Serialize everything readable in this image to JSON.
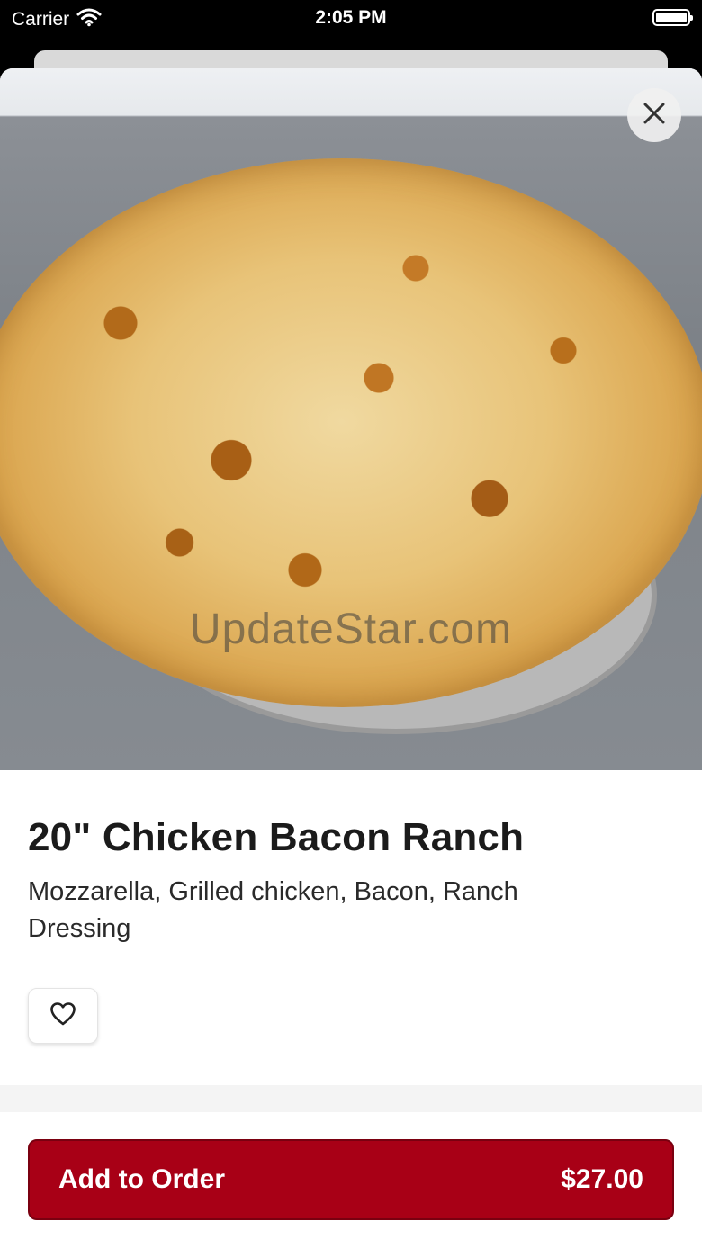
{
  "status_bar": {
    "carrier": "Carrier",
    "time": "2:05 PM",
    "wifi_icon": "wifi-icon",
    "battery_icon": "battery-full-icon"
  },
  "hero": {
    "image_subject": "pizza photo",
    "watermark": "UpdateStar.com",
    "close_icon": "close-icon"
  },
  "item": {
    "title": "20\" Chicken Bacon Ranch",
    "description": "Mozzarella, Grilled chicken, Bacon, Ranch Dressing",
    "favorite_icon": "heart-outline-icon"
  },
  "footer": {
    "add_label": "Add to Order",
    "price": "$27.00"
  },
  "colors": {
    "accent": "#a80016",
    "background": "#ffffff",
    "text": "#1b1b1b"
  }
}
